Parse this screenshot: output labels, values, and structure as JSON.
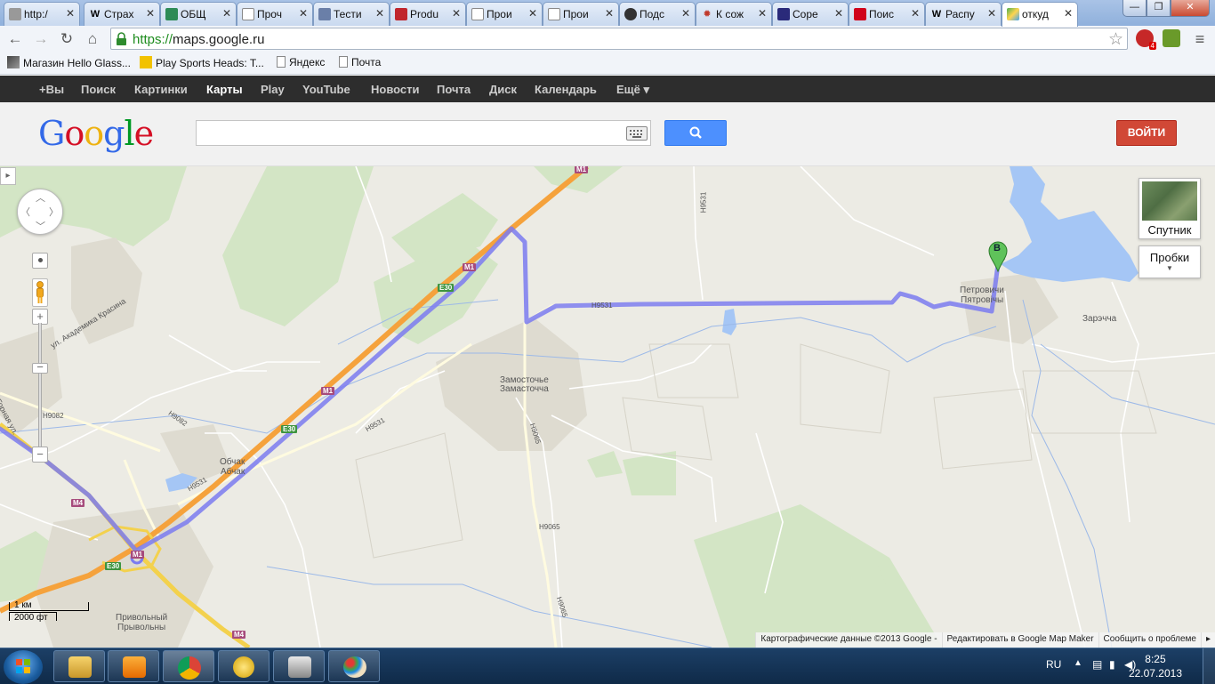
{
  "browser": {
    "tabs": [
      {
        "label": "http:/",
        "icon": "page-icon"
      },
      {
        "label": "Страх",
        "icon": "wikipedia-icon"
      },
      {
        "label": "ОБЩ",
        "icon": "site-icon"
      },
      {
        "label": "Проч",
        "icon": "page-icon"
      },
      {
        "label": "Тести",
        "icon": "site-icon"
      },
      {
        "label": "Produ",
        "icon": "site-icon"
      },
      {
        "label": "Прои",
        "icon": "page-icon"
      },
      {
        "label": "Прои",
        "icon": "page-icon"
      },
      {
        "label": "Подс",
        "icon": "compass-icon"
      },
      {
        "label": "К сож",
        "icon": "gear-icon"
      },
      {
        "label": "Соре",
        "icon": "site-icon"
      },
      {
        "label": "Поис",
        "icon": "site-icon"
      },
      {
        "label": "Распу",
        "icon": "wikipedia-icon"
      },
      {
        "label": "откуд",
        "icon": "google-maps-icon"
      }
    ],
    "url_scheme": "https://",
    "url_host": "maps.google.ru",
    "extension_badge": "4",
    "bookmarks": [
      {
        "label": "Магазин Hello Glass..."
      },
      {
        "label": "Play Sports Heads: T..."
      },
      {
        "label": "Яндекс"
      },
      {
        "label": "Почта"
      }
    ]
  },
  "google_bar": {
    "items": [
      "+Вы",
      "Поиск",
      "Картинки",
      "Карты",
      "Play",
      "YouTube",
      "Новости",
      "Почта",
      "Диск",
      "Календарь",
      "Ещё ▾"
    ],
    "active": "Карты"
  },
  "header": {
    "logo": "Google",
    "search_value": "",
    "signin_label": "ВОЙТИ"
  },
  "map": {
    "labels": {
      "zamostochye_ru": "Замосточье",
      "zamostochye_be": "Замасточча",
      "petrovichi_ru": "Петровичи",
      "petrovichi_be": "Пятровічы",
      "zarechcha": "Зарэчча",
      "obchak_ru": "Обчак",
      "obchak_be": "Абчак",
      "privolny_ru": "Привольный",
      "privolny_be": "Прывольны",
      "street_krasina": "ул. Академика Красина",
      "street_gornaya": "Горная ул.",
      "road_h9531_a": "H9531",
      "road_h9531_b": "H9531",
      "road_h9531_c": "H9531",
      "road_h9531_d": "H9531",
      "road_h9065_a": "H9065",
      "road_h9065_b": "H9065",
      "road_h9065_c": "H9065",
      "road_h9082_a": "H9082",
      "road_h9082_b": "H9082"
    },
    "shields": {
      "m1": "M1",
      "m4": "M4",
      "e30": "E30"
    },
    "marker_label": "B",
    "satellite_label": "Спутник",
    "traffic_label": "Пробки",
    "scale_km": "1 км",
    "scale_ft": "2000 фт",
    "attribution": "Картографические данные ©2013 Google -",
    "edit_link": "Редактировать в Google Map Maker",
    "report_link": "Сообщить о проблеме",
    "colors": {
      "route": "#7b7bf0",
      "motorway": "#f5a23c",
      "water": "#a5c6f5",
      "green": "#d3e5c5",
      "urban": "#dedbd0"
    }
  },
  "taskbar": {
    "apps": [
      "file-explorer-icon",
      "media-player-icon",
      "chrome-icon",
      "globe-icon",
      "camera-icon",
      "paint-icon"
    ],
    "language": "RU",
    "time": "8:25",
    "date": "22.07.2013"
  }
}
